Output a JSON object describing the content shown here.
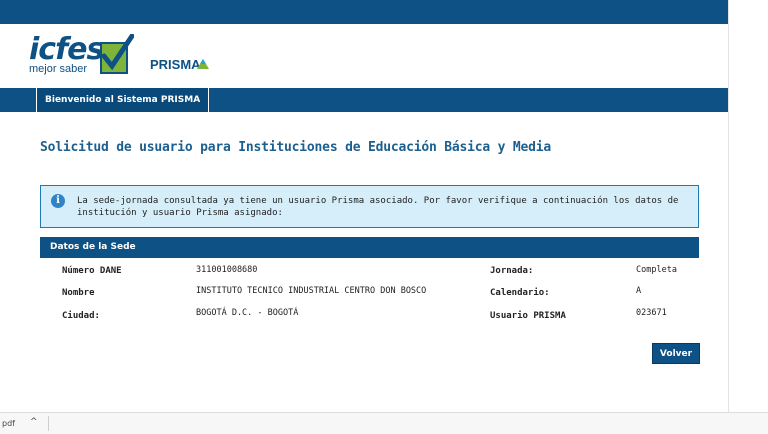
{
  "logo": {
    "brand": "icfes",
    "tagline": "mejor saber",
    "product": "PRISMA"
  },
  "colors": {
    "primary": "#0d5185",
    "check_green": "#7fb43b",
    "info_bg": "#d5eef9"
  },
  "nav": {
    "tab_label": "Bienvenido al Sistema PRISMA"
  },
  "page_title": "Solicitud de usuario para Instituciones de Educación Básica y Media",
  "info": {
    "icon": "info-icon",
    "message": "La sede-jornada consultada ya tiene un usuario Prisma asociado. Por favor verifique a continuación los datos de institución y usuario Prisma asignado:"
  },
  "sede": {
    "title": "Datos de la Sede",
    "fields": {
      "dane_label": "Número DANE",
      "dane_value": "311001008680",
      "nombre_label": "Nombre",
      "nombre_value": "INSTITUTO TECNICO INDUSTRIAL CENTRO DON BOSCO",
      "ciudad_label": "Ciudad:",
      "ciudad_value": "BOGOTÁ D.C. - BOGOTÁ",
      "jornada_label": "Jornada:",
      "jornada_value": "Completa",
      "calendario_label": "Calendario:",
      "calendario_value": "A",
      "usuario_label": "Usuario PRISMA",
      "usuario_value": "023671"
    }
  },
  "buttons": {
    "volver": "Volver"
  },
  "bottom": {
    "text": "pdf",
    "chevron": "^"
  }
}
